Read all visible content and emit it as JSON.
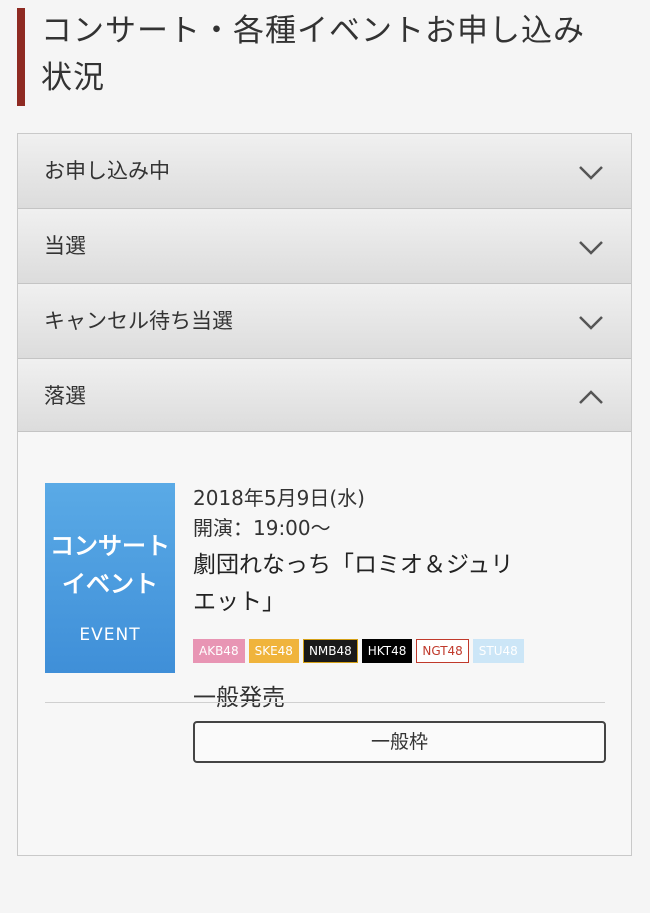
{
  "page_title": [
    "コンサート・各種イベントお申し込み",
    "状況"
  ],
  "sections": [
    {
      "label": "お申し込み中",
      "state": "collapsed"
    },
    {
      "label": "当選",
      "state": "collapsed"
    },
    {
      "label": "キャンセル待ち当選",
      "state": "collapsed"
    },
    {
      "label": "落選",
      "state": "expanded"
    }
  ],
  "event": {
    "thumbnail": {
      "line1": "コンサート",
      "line2": "イベント",
      "line3": "EVENT"
    },
    "date": "2018年5月9日(水)",
    "time": "開演：19:00〜",
    "title": "劇団れなっち「ロミオ＆ジュリエット」",
    "title_lines": [
      "劇団れなっち「ロミオ＆ジュリ",
      "エット」"
    ],
    "groups": [
      {
        "label": "AKB48",
        "bg": "#e895b4",
        "fg": "#ffffff",
        "border": "#e895b4"
      },
      {
        "label": "SKE48",
        "bg": "#f0b43c",
        "fg": "#ffffff",
        "border": "#f0b43c"
      },
      {
        "label": "NMB48",
        "bg": "#1a1a1a",
        "fg": "#ffffff",
        "border": "#d4a017"
      },
      {
        "label": "HKT48",
        "bg": "#000000",
        "fg": "#ffffff",
        "border": "#000000"
      },
      {
        "label": "NGT48",
        "bg": "#ffffff",
        "fg": "#c0392b",
        "border": "#c0392b"
      },
      {
        "label": "STU48",
        "bg": "#cce6f7",
        "fg": "#ffffff",
        "border": "#cce6f7"
      }
    ],
    "sale_type": "一般発売",
    "category_button": "一般枠"
  },
  "colors": {
    "title_accent": "#8e2a22",
    "thumbnail": "#4a9be0"
  }
}
